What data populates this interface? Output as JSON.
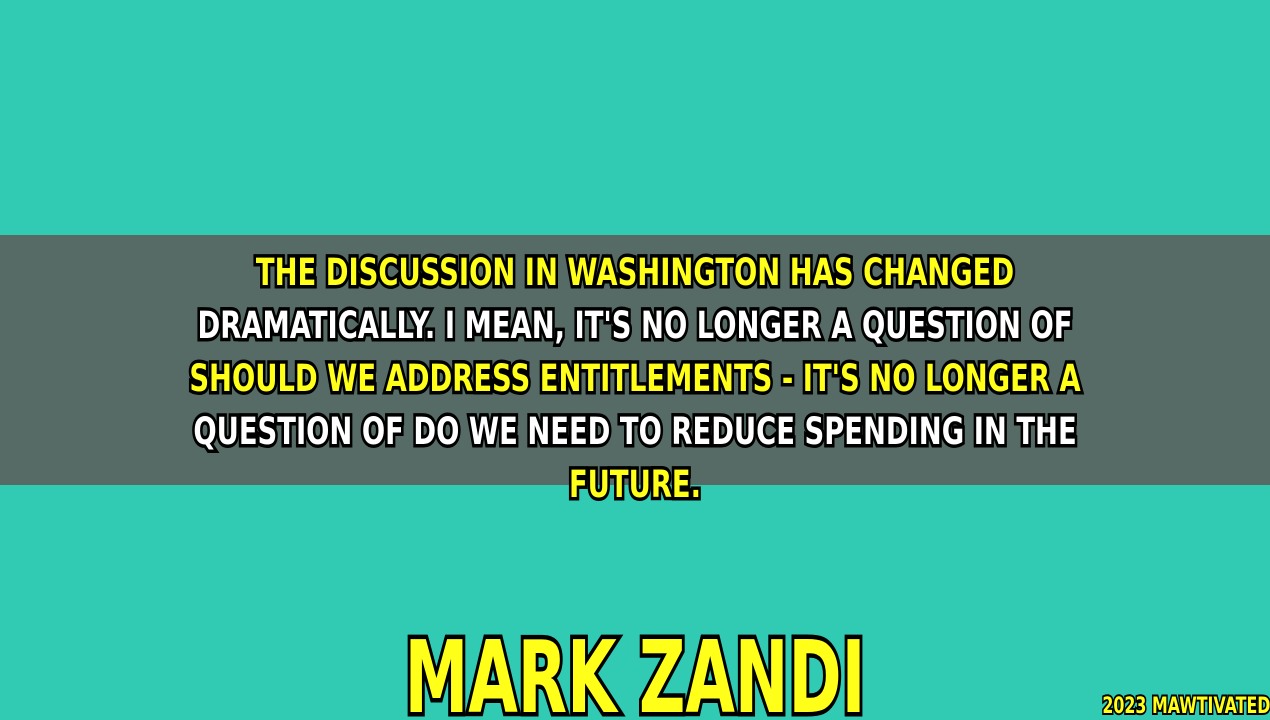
{
  "quote": {
    "lines": [
      "THE DISCUSSION IN WASHINGTON HAS CHANGED",
      "DRAMATICALLY. I MEAN, IT'S NO LONGER A QUESTION OF",
      "SHOULD WE ADDRESS ENTITLEMENTS - IT'S NO LONGER A",
      "QUESTION OF DO WE NEED TO REDUCE SPENDING IN THE",
      "FUTURE."
    ]
  },
  "author": "MARK ZANDI",
  "watermark": "2023 MAWTIVATED",
  "colors": {
    "background": "#31CBB4",
    "band": "#566B66",
    "yellow": "#FFFF1A",
    "white": "#FFFFFF",
    "outline": "#000000"
  }
}
